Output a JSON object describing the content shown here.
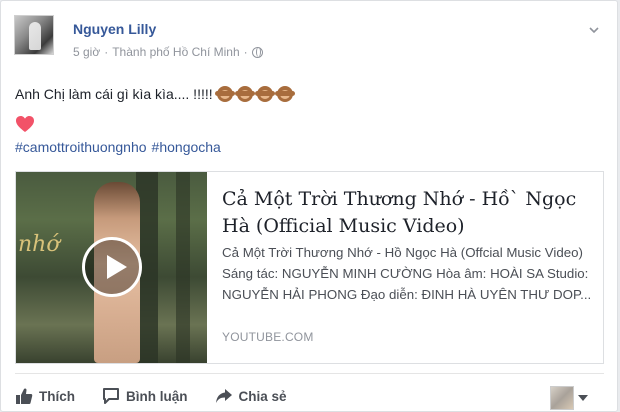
{
  "post": {
    "author": "Nguyen Lilly",
    "time": "5 giờ",
    "separator": "·",
    "location": "Thành phố Hồ Chí Minh",
    "separator2": "·",
    "text": "Anh Chị làm cái gì kìa kìa.... !!!!!",
    "hashtags": [
      "#camottroithuongnho",
      "#hongocha"
    ]
  },
  "link": {
    "title": "Cả Một Trời Thương Nhớ - Hồ` Ngọc Hà (Official Music Video)",
    "description": "Cả Một Trời Thương Nhớ - Hồ Ngọc Hà (Offcial Music Video) Sáng tác: NGUYỄN MINH CƯỜNG Hòa âm: HOÀI SA Studio: NGUYỄN HẢI PHONG Đạo diễn: ĐINH HÀ UYÊN THƯ DOP...",
    "domain": "YOUTUBE.COM",
    "thumb_script": "nhớ"
  },
  "actions": {
    "like": "Thích",
    "comment": "Bình luận",
    "share": "Chia sẻ"
  },
  "icons": {
    "globe": "globe-icon",
    "chevron": "chevron-down-icon",
    "heart": "heart-icon",
    "play": "play-icon",
    "like": "thumbs-up-icon",
    "comment": "comment-icon",
    "share": "share-icon",
    "emoji": "see-no-evil-monkey-icon"
  },
  "colors": {
    "link_blue": "#365899",
    "meta_gray": "#90949c",
    "heart_pink": "#f25268"
  }
}
